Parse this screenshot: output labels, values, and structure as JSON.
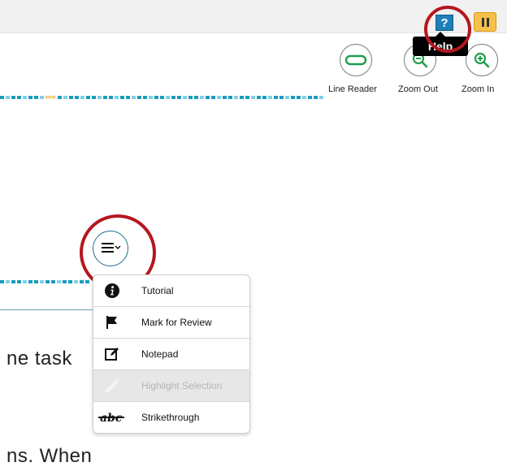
{
  "topbar": {
    "help_button_glyph": "?",
    "help_tooltip": "Help",
    "pause_icon": "pause-icon"
  },
  "tools": {
    "line_reader": "Line Reader",
    "zoom_out": "Zoom Out",
    "zoom_in": "Zoom In"
  },
  "context_menu": {
    "trigger_icon": "menu-chevron-icon",
    "items": [
      {
        "label": "Tutorial",
        "icon": "info-icon",
        "enabled": true
      },
      {
        "label": "Mark for Review",
        "icon": "flag-icon",
        "enabled": true
      },
      {
        "label": "Notepad",
        "icon": "notepad-icon",
        "enabled": true
      },
      {
        "label": "Highlight Selection",
        "icon": "highlighter-icon",
        "enabled": false
      },
      {
        "label": "Strikethrough",
        "icon": "strikethrough-icon",
        "enabled": true
      }
    ]
  },
  "content": {
    "line1": "ne task",
    "line2": "ns. When"
  },
  "colors": {
    "callout_red": "#b4171f",
    "help_blue": "#1f7fb8",
    "pause_yellow": "#f7c04a",
    "progress_teal": "#1a9bbf",
    "progress_light": "#7fd0e6",
    "current_marker": "#f0b43c"
  }
}
